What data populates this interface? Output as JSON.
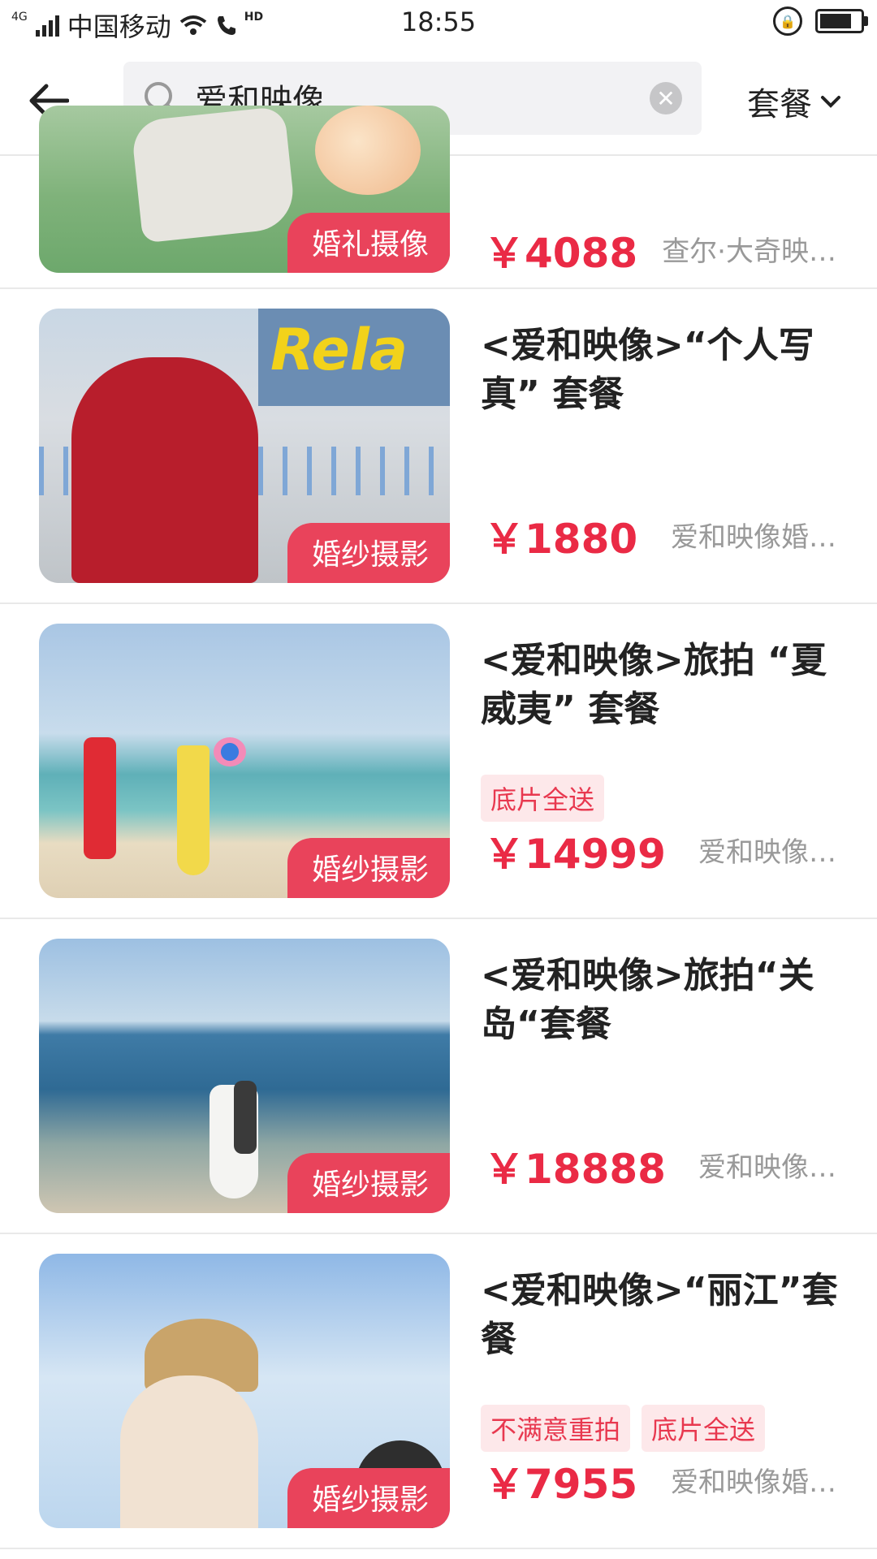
{
  "status_bar": {
    "network": "4G",
    "carrier": "中国移动",
    "hd": "HD",
    "time": "18:55"
  },
  "header": {
    "search_text": "爱和映像",
    "filter_label": "套餐"
  },
  "items": [
    {
      "badge": "婚礼摄像",
      "title": "",
      "tags": [],
      "price": "￥4088",
      "shop": "查尔·大奇映…"
    },
    {
      "badge": "婚纱摄影",
      "title": "<爱和映像>“个人写真” 套餐",
      "tags": [],
      "price": "￥1880",
      "shop": "爱和映像婚…"
    },
    {
      "badge": "婚纱摄影",
      "title": "<爱和映像>旅拍 “夏威夷” 套餐",
      "tags": [
        "底片全送"
      ],
      "price": "￥14999",
      "shop": "爱和映像…"
    },
    {
      "badge": "婚纱摄影",
      "title": "<爱和映像>旅拍“关岛“套餐",
      "tags": [],
      "price": "￥18888",
      "shop": "爱和映像…"
    },
    {
      "badge": "婚纱摄影",
      "title": "<爱和映像>“丽江”套餐",
      "tags": [
        "不满意重拍",
        "底片全送"
      ],
      "price": "￥7955",
      "shop": "爱和映像婚…"
    }
  ]
}
